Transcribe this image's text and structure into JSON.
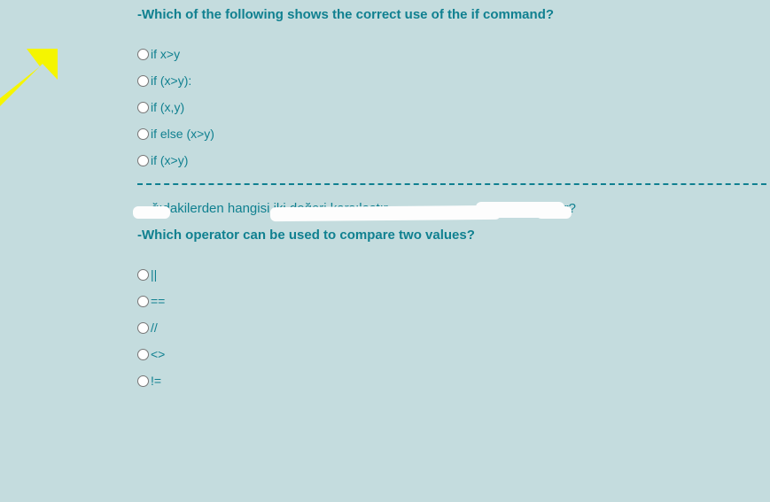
{
  "q1": {
    "prompt": "-Which of the following shows the correct use of the if command?",
    "options": [
      "if x>y",
      "if (x>y):",
      "if (x,y)",
      "if else (x>y)",
      "if (x>y)"
    ]
  },
  "obscured": {
    "frag1": "-",
    "frag2": "ğıdakilerden hangisi iki değeri karşılaştır",
    "frag3": "ılır?"
  },
  "q2": {
    "prompt": "-Which operator can be used to compare two values?",
    "options": [
      "||",
      "==",
      "//",
      "<>",
      "!="
    ]
  }
}
